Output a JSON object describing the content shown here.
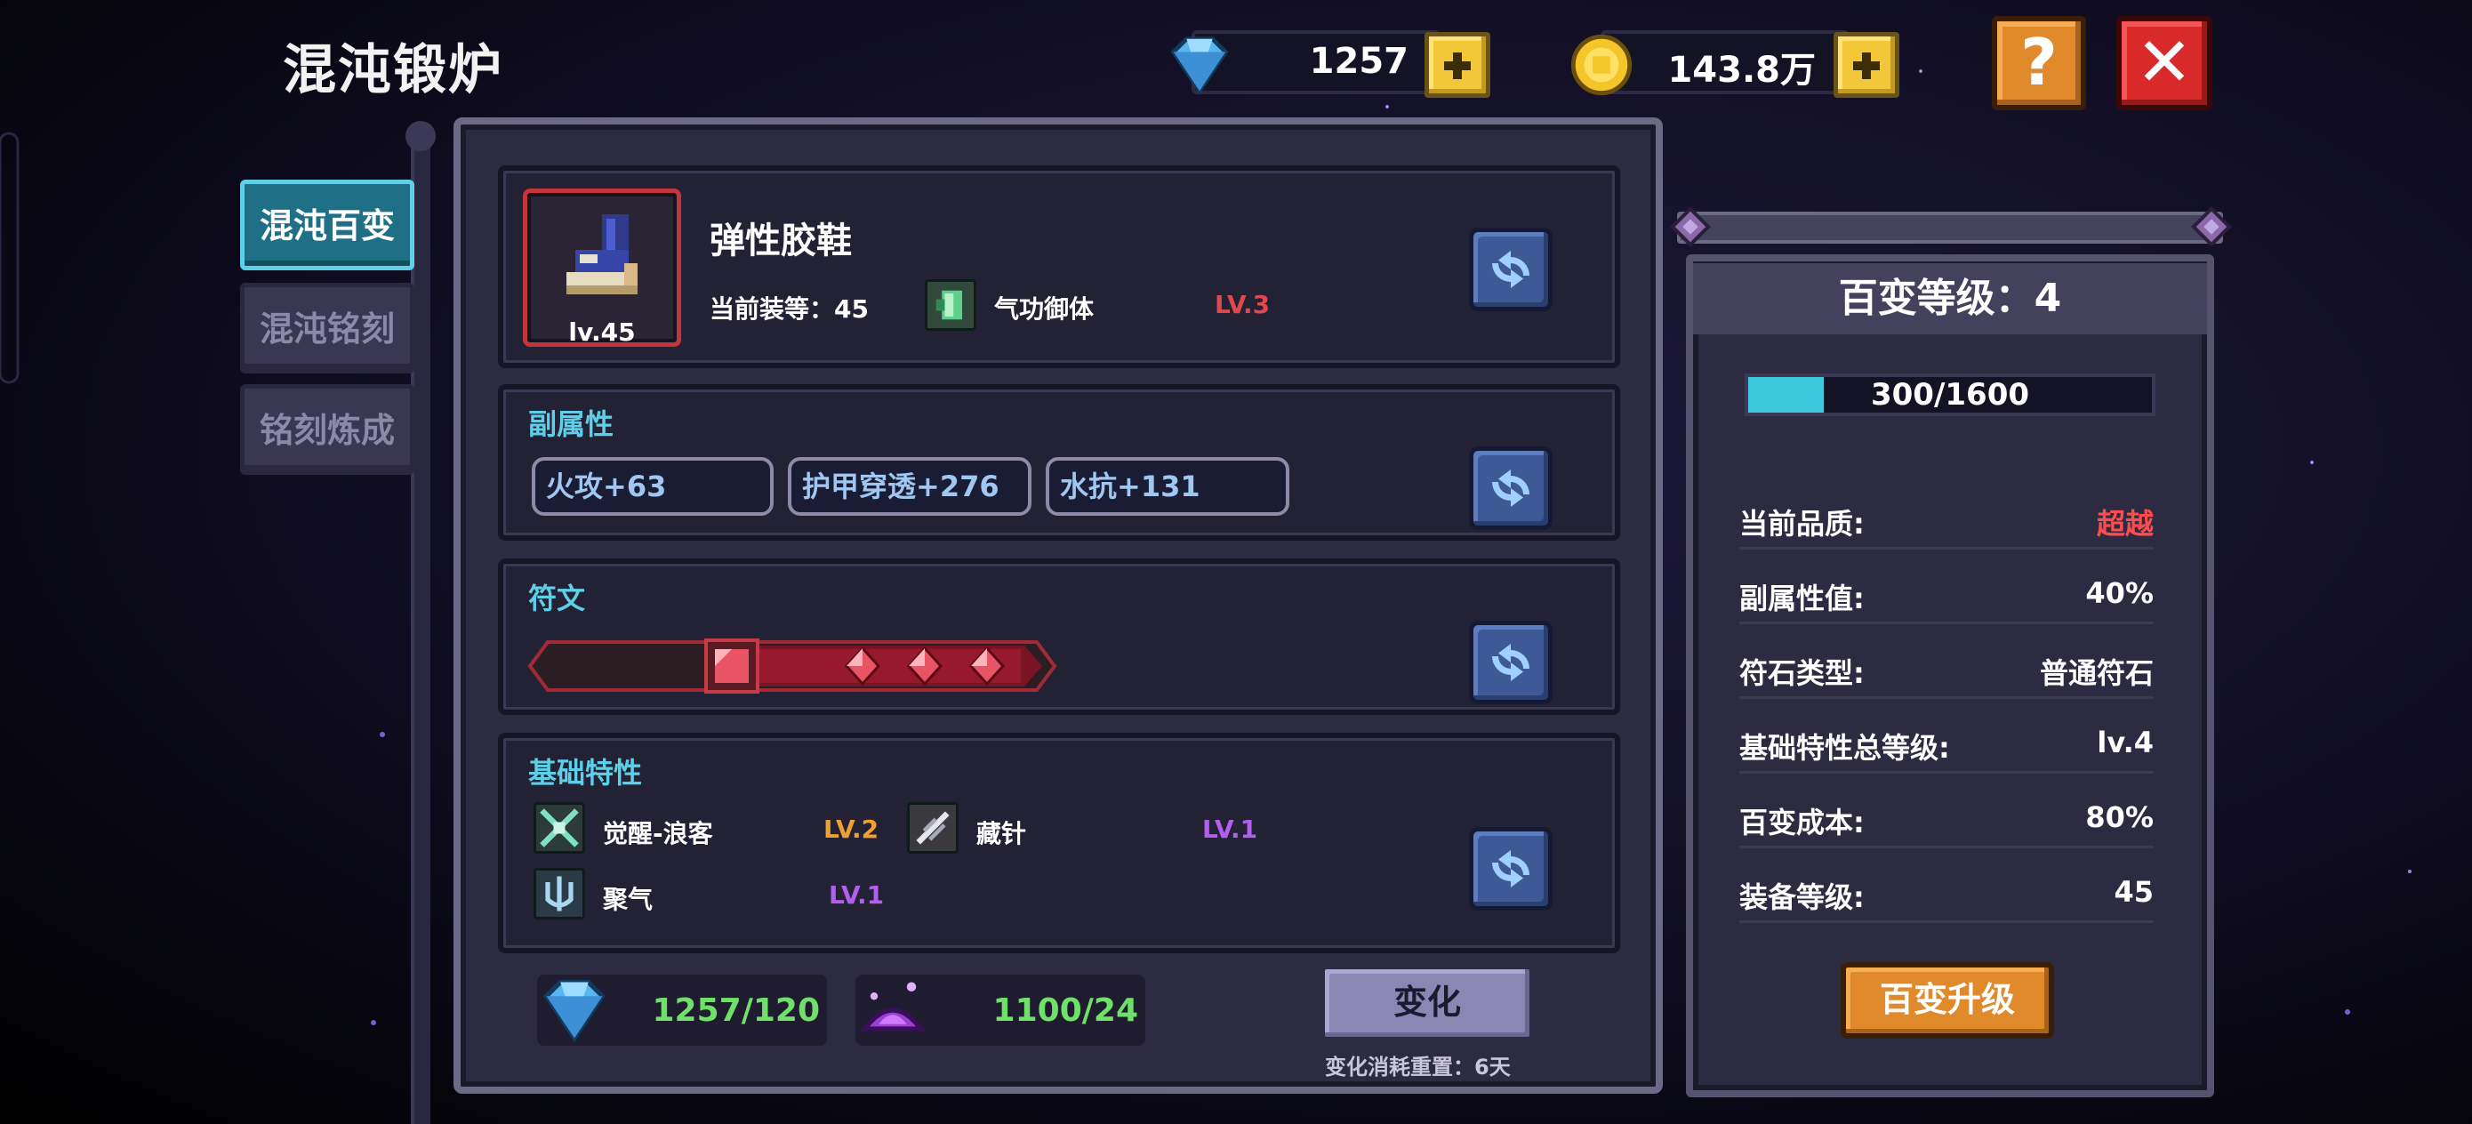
{
  "header": {
    "title": "混沌锻炉",
    "gems": "1257",
    "gold": "143.8万",
    "help_label": "?",
    "close_label": "✕"
  },
  "tabs": [
    {
      "label": "混沌百变",
      "active": true
    },
    {
      "label": "混沌铭刻",
      "active": false
    },
    {
      "label": "铭刻炼成",
      "active": false
    }
  ],
  "item": {
    "name": "弹性胶鞋",
    "level_badge": "lv.45",
    "gear_level_text": "当前装等：45",
    "skill_name": "气功御体",
    "skill_level": "LV.3"
  },
  "sub_attrs": {
    "title": "副属性",
    "items": [
      "火攻+63",
      "护甲穿透+276",
      "水抗+131"
    ]
  },
  "rune": {
    "title": "符文",
    "gem_count": 4
  },
  "base_traits": {
    "title": "基础特性",
    "items": [
      {
        "name": "觉醒-浪客",
        "level": "LV.2",
        "color": "#f0a030"
      },
      {
        "name": "藏针",
        "level": "LV.1",
        "color": "#b25ef0"
      },
      {
        "name": "聚气",
        "level": "LV.1",
        "color": "#b25ef0"
      }
    ]
  },
  "cost": {
    "gem_cost": "1257/120",
    "dust_cost": "1100/24",
    "change_label": "变化",
    "reset_note": "变化消耗重置：6天"
  },
  "right_panel": {
    "title": "百变等级：4",
    "exp_text": "300/1600",
    "exp_fraction": 0.1875,
    "stats": [
      {
        "label": "当前品质:",
        "value": "超越",
        "color": "#ff4d4f"
      },
      {
        "label": "副属性值:",
        "value": "40%",
        "color": "#ffffff"
      },
      {
        "label": "符石类型:",
        "value": "普通符石",
        "color": "#ffffff"
      },
      {
        "label": "基础特性总等级:",
        "value": "lv.4",
        "color": "#ffffff"
      },
      {
        "label": "百变成本:",
        "value": "80%",
        "color": "#ffffff"
      },
      {
        "label": "装备等级:",
        "value": "45",
        "color": "#ffffff"
      }
    ],
    "upgrade_label": "百变升级"
  },
  "colors": {
    "accent_cyan": "#5ecfe8",
    "quality_red": "#ff4d4f",
    "cost_green": "#6fe06a"
  }
}
